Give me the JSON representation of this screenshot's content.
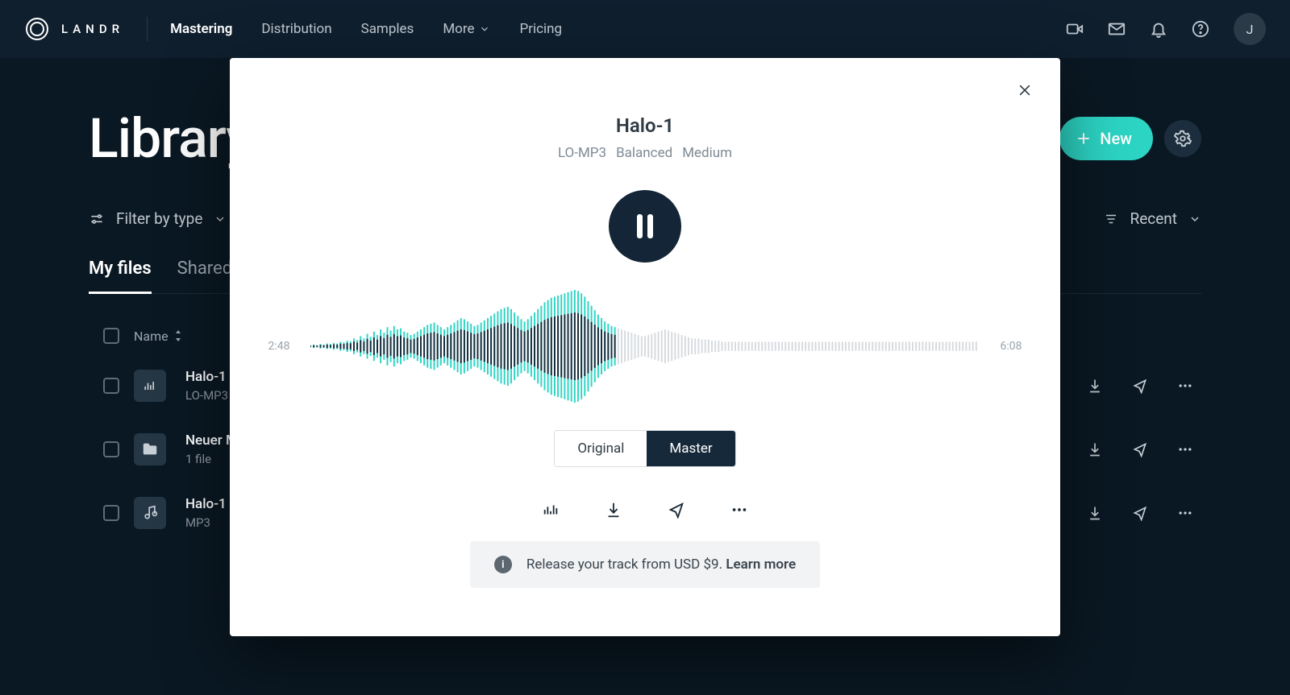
{
  "brand": "LANDR",
  "nav": {
    "items": [
      "Mastering",
      "Distribution",
      "Samples",
      "More",
      "Pricing"
    ],
    "active_index": 0
  },
  "avatar_initial": "J",
  "page": {
    "title": "Library",
    "new_button": "New",
    "filter_label": "Filter by type",
    "sort_label": "Recent"
  },
  "tabs": {
    "items": [
      "My files",
      "Shared"
    ],
    "active_index": 0
  },
  "columns": {
    "name": "Name"
  },
  "rows": [
    {
      "name": "Halo-1",
      "sub": "LO-MP3",
      "icon": "bars"
    },
    {
      "name": "Neuer M",
      "sub": "1 file",
      "icon": "folder"
    },
    {
      "name": "Halo-1",
      "sub": "MP3",
      "icon": "note"
    }
  ],
  "modal": {
    "title": "Halo-1",
    "meta": [
      "LO-MP3",
      "Balanced",
      "Medium"
    ],
    "time_current": "2:48",
    "time_total": "6:08",
    "progress_fraction": 0.46,
    "toggle": {
      "options": [
        "Original",
        "Master"
      ],
      "selected_index": 1
    },
    "promo_text": "Release your track from USD $9. ",
    "promo_link": "Learn more"
  },
  "waveform": {
    "bars": 200,
    "amps": [
      2,
      3,
      2,
      4,
      3,
      5,
      4,
      6,
      5,
      8,
      7,
      10,
      9,
      14,
      11,
      18,
      14,
      22,
      17,
      26,
      20,
      30,
      24,
      34,
      28,
      36,
      30,
      32,
      26,
      24,
      20,
      22,
      26,
      30,
      34,
      38,
      40,
      42,
      38,
      34,
      30,
      34,
      38,
      42,
      46,
      50,
      48,
      44,
      40,
      36,
      38,
      42,
      46,
      50,
      54,
      58,
      62,
      66,
      68,
      70,
      66,
      60,
      54,
      48,
      44,
      48,
      54,
      60,
      66,
      72,
      78,
      82,
      86,
      88,
      90,
      92,
      94,
      96,
      98,
      100,
      98,
      94,
      88,
      80,
      72,
      64,
      56,
      50,
      44,
      40,
      36,
      34,
      32,
      30,
      28,
      26,
      24,
      22,
      20,
      18,
      18,
      20,
      22,
      24,
      26,
      28,
      30,
      28,
      26,
      24,
      22,
      20,
      18,
      16,
      14,
      14,
      14,
      12,
      12,
      12,
      10,
      10,
      10,
      8,
      8,
      8,
      8,
      8,
      8,
      8,
      8,
      8,
      8,
      8,
      8,
      8,
      8,
      8,
      8,
      8,
      8,
      8,
      8,
      8,
      8,
      8,
      8,
      8,
      8,
      8,
      8,
      8,
      8,
      8,
      8,
      8,
      8,
      8,
      8,
      8,
      8,
      8,
      8,
      8,
      8,
      8,
      8,
      8,
      8,
      8,
      8,
      8,
      8,
      8,
      8,
      8,
      8,
      8,
      8,
      8,
      8,
      8,
      8,
      8,
      8,
      8,
      8,
      8,
      8,
      8,
      8,
      8,
      8,
      8,
      8,
      8,
      8,
      8,
      8,
      8
    ]
  }
}
